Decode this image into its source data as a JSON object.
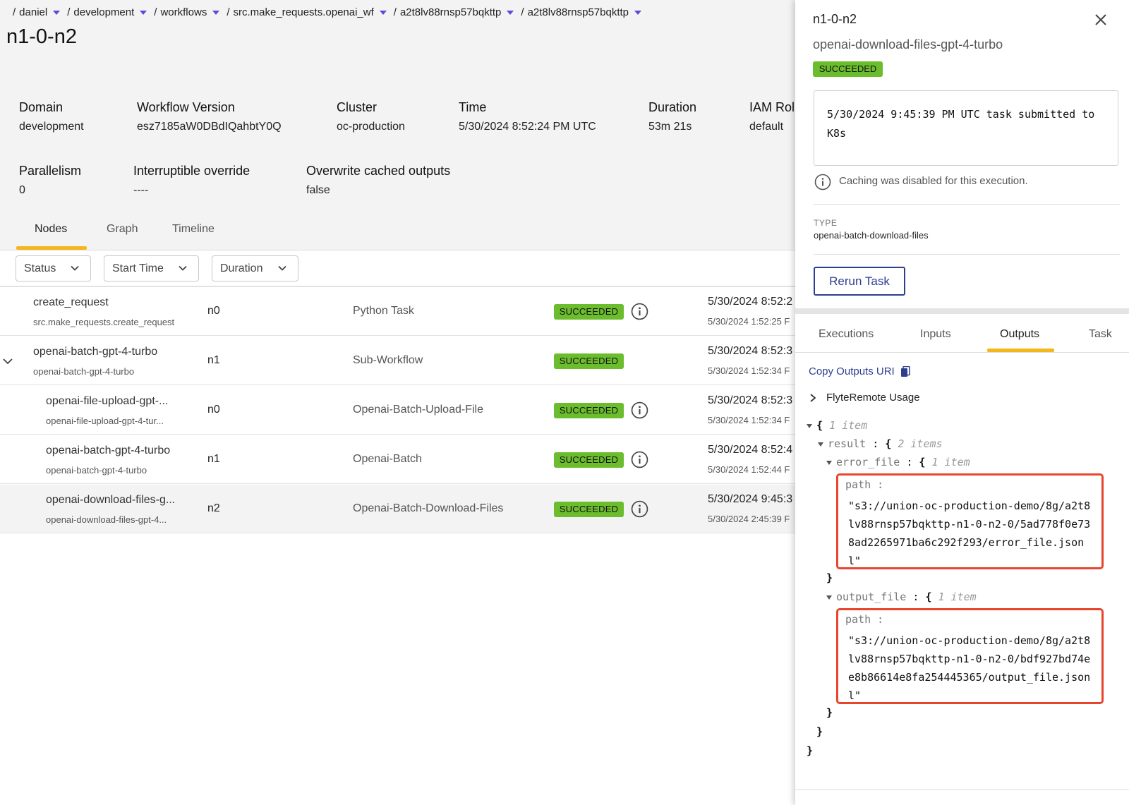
{
  "breadcrumb": [
    "daniel",
    "development",
    "workflows",
    "src.make_requests.openai_wf",
    "a2t8lv88rnsp57bqkttp",
    "a2t8lv88rnsp57bqkttp"
  ],
  "page_title": "n1-0-n2",
  "meta": {
    "domain": {
      "label": "Domain",
      "value": "development"
    },
    "workflow_version": {
      "label": "Workflow Version",
      "value": "esz7185aW0DBdIQahbtY0Q"
    },
    "cluster": {
      "label": "Cluster",
      "value": "oc-production"
    },
    "time": {
      "label": "Time",
      "value": "5/30/2024 8:52:24 PM UTC"
    },
    "duration": {
      "label": "Duration",
      "value": "53m 21s"
    },
    "iam_role": {
      "label": "IAM Rol",
      "value": "default"
    },
    "parallelism": {
      "label": "Parallelism",
      "value": "0"
    },
    "interruptible": {
      "label": "Interruptible override",
      "value": "----"
    },
    "overwrite": {
      "label": "Overwrite cached outputs",
      "value": "false"
    }
  },
  "tabs": [
    "Nodes",
    "Graph",
    "Timeline"
  ],
  "filters": [
    "Status",
    "Start Time",
    "Duration"
  ],
  "rows": [
    {
      "name": "create_request",
      "sub": "src.make_requests.create_request",
      "id": "n0",
      "type": "Python Task",
      "status": "SUCCEEDED",
      "time": "5/30/2024 8:52:2",
      "time_sub": "5/30/2024 1:52:25 F"
    },
    {
      "name": "openai-batch-gpt-4-turbo",
      "sub": "openai-batch-gpt-4-turbo",
      "id": "n1",
      "type": "Sub-Workflow",
      "status": "SUCCEEDED",
      "time": "5/30/2024 8:52:3",
      "time_sub": "5/30/2024 1:52:34 F"
    },
    {
      "name": "openai-file-upload-gpt-...",
      "sub": "openai-file-upload-gpt-4-tur...",
      "id": "n0",
      "type": "Openai-Batch-Upload-File",
      "status": "SUCCEEDED",
      "time": "5/30/2024 8:52:3",
      "time_sub": "5/30/2024 1:52:34 F"
    },
    {
      "name": "openai-batch-gpt-4-turbo",
      "sub": "openai-batch-gpt-4-turbo",
      "id": "n1",
      "type": "Openai-Batch",
      "status": "SUCCEEDED",
      "time": "5/30/2024 8:52:4",
      "time_sub": "5/30/2024 1:52:44 F"
    },
    {
      "name": "openai-download-files-g...",
      "sub": "openai-download-files-gpt-4...",
      "id": "n2",
      "type": "Openai-Batch-Download-Files",
      "status": "SUCCEEDED",
      "time": "5/30/2024 9:45:3",
      "time_sub": "5/30/2024 2:45:39 F"
    }
  ],
  "drawer": {
    "title": "n1-0-n2",
    "subtitle": "openai-download-files-gpt-4-turbo",
    "status": "SUCCEEDED",
    "log": "5/30/2024 9:45:39 PM UTC task submitted to K8s",
    "cache_note": "Caching was disabled for this execution.",
    "type_label": "TYPE",
    "type_value": "openai-batch-download-files",
    "rerun_label": "Rerun Task",
    "tabs": [
      "Executions",
      "Inputs",
      "Outputs",
      "Task"
    ],
    "copy_uri_label": "Copy Outputs URI",
    "flyte_remote_label": "FlyteRemote Usage"
  },
  "json_viewer": {
    "root_count": "1 item",
    "result_key": "result",
    "result_count": "2 items",
    "error_key": "error_file",
    "error_count": "1 item",
    "error_path_key": "path",
    "error_path_value": "\"s3://union-oc-production-demo/8g/a2t8lv88rnsp57bqkttp-n1-0-n2-0/5ad778f0e738ad2265971ba6c292f293/error_file.jsonl\"",
    "output_key": "output_file",
    "output_count": "1 item",
    "output_path_key": "path",
    "output_path_value": "\"s3://union-oc-production-demo/8g/a2t8lv88rnsp57bqkttp-n1-0-n2-0/bdf927bd74ee8b86614e8fa254445365/output_file.jsonl\""
  },
  "colors": {
    "accent_tab_underline": "#f5b61a",
    "status_success": "#6bbd2e",
    "breadcrumb_caret": "#5b4bd8",
    "link_blue": "#2f3e8f",
    "highlight_red": "#e8452c"
  },
  "icons": [
    "chevron-down-icon",
    "info-icon",
    "close-icon",
    "copy-icon",
    "chevron-right-icon",
    "caret-down-icon"
  ]
}
